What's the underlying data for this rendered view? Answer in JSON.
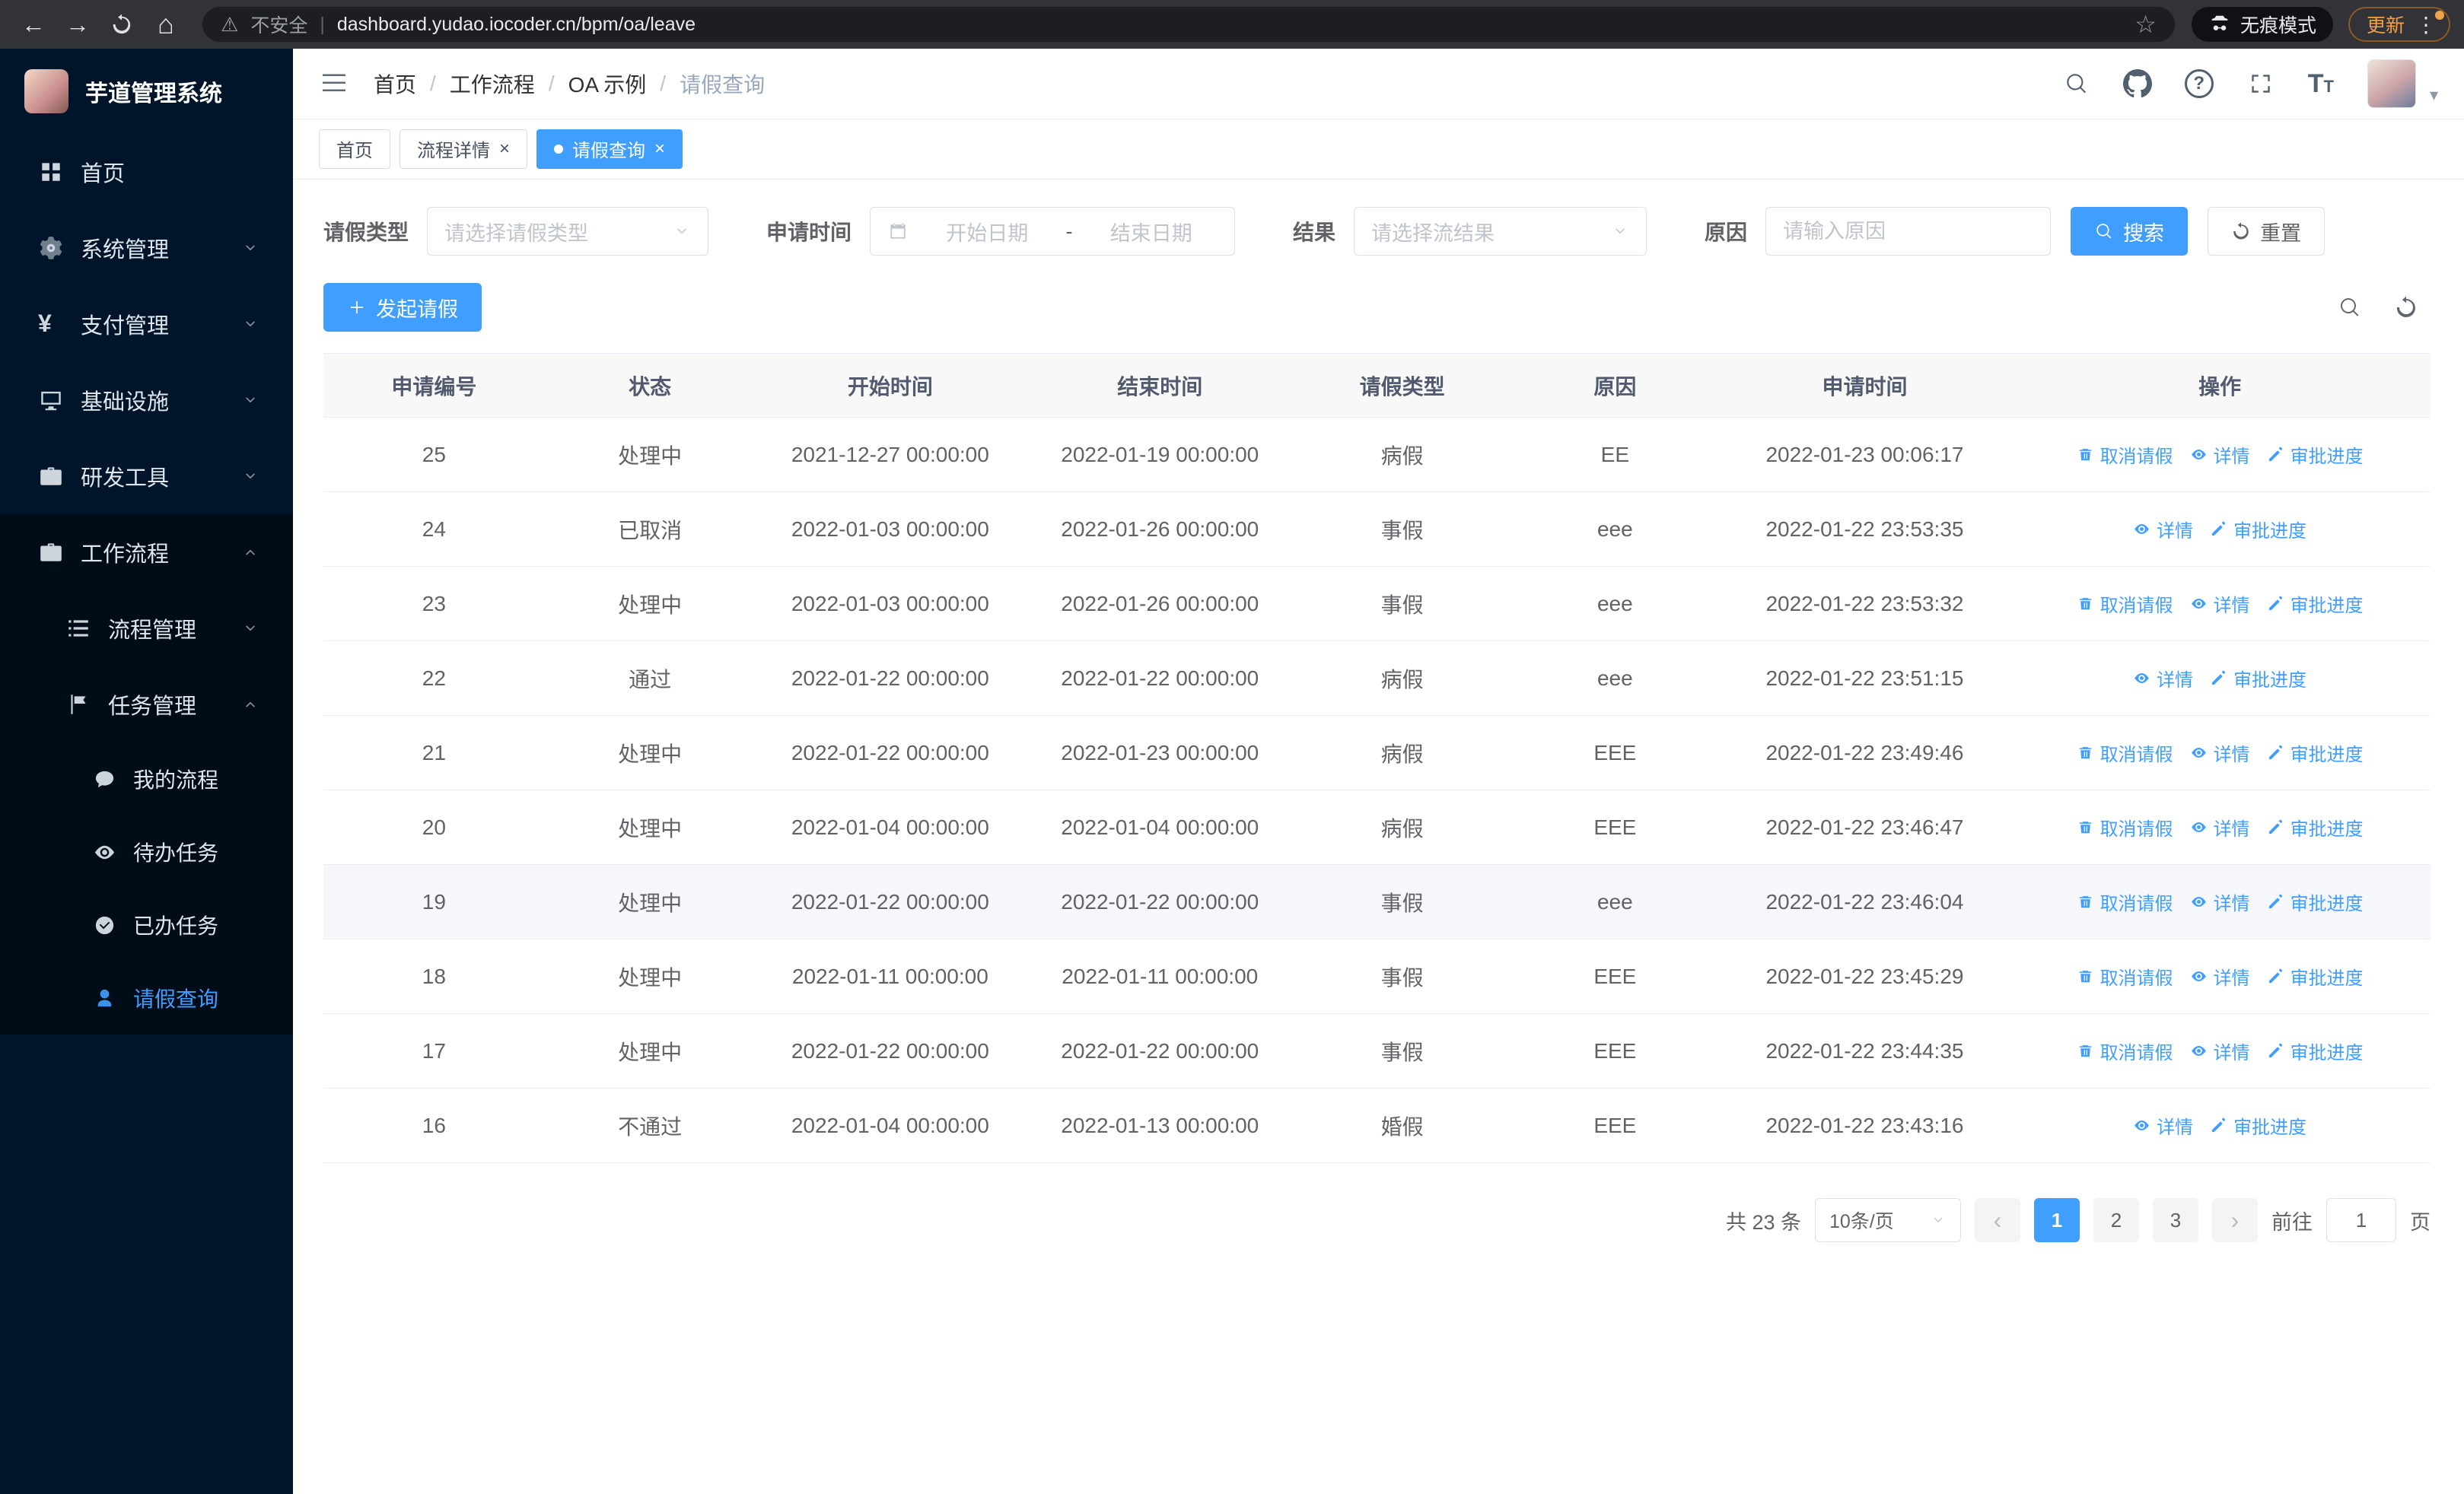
{
  "colors": {
    "accent": "#409eff",
    "sidebar_bg": "#001529",
    "sidebar_sub_bg": "#000c17"
  },
  "browser": {
    "security_label": "不安全",
    "url": "dashboard.yudao.iocoder.cn/bpm/oa/leave",
    "incognito_label": "无痕模式",
    "update_label": "更新"
  },
  "sidebar": {
    "title": "芋道管理系统",
    "items": [
      {
        "label": "首页"
      },
      {
        "label": "系统管理"
      },
      {
        "label": "支付管理"
      },
      {
        "label": "基础设施"
      },
      {
        "label": "研发工具"
      },
      {
        "label": "工作流程"
      },
      {
        "label": "流程管理"
      },
      {
        "label": "任务管理"
      },
      {
        "label": "我的流程"
      },
      {
        "label": "待办任务"
      },
      {
        "label": "已办任务"
      },
      {
        "label": "请假查询"
      }
    ]
  },
  "breadcrumb": [
    "首页",
    "工作流程",
    "OA 示例",
    "请假查询"
  ],
  "tabs": [
    {
      "label": "首页"
    },
    {
      "label": "流程详情"
    },
    {
      "label": "请假查询"
    }
  ],
  "filters": {
    "leave_type_label": "请假类型",
    "leave_type_placeholder": "请选择请假类型",
    "apply_time_label": "申请时间",
    "start_placeholder": "开始日期",
    "range_separator": "-",
    "end_placeholder": "结束日期",
    "result_label": "结果",
    "result_placeholder": "请选择流结果",
    "reason_label": "原因",
    "reason_placeholder": "请输入原因",
    "search_label": "搜索",
    "reset_label": "重置"
  },
  "toolbar": {
    "create_label": "发起请假"
  },
  "table": {
    "columns": [
      "申请编号",
      "状态",
      "开始时间",
      "结束时间",
      "请假类型",
      "原因",
      "申请时间",
      "操作"
    ],
    "action_labels": {
      "cancel": "取消请假",
      "detail": "详情",
      "progress": "审批进度"
    },
    "rows": [
      {
        "id": "25",
        "status": "处理中",
        "start": "2021-12-27 00:00:00",
        "end": "2022-01-19 00:00:00",
        "type": "病假",
        "reason": "EE",
        "applied": "2022-01-23 00:06:17",
        "cancelable": true,
        "highlighted": false
      },
      {
        "id": "24",
        "status": "已取消",
        "start": "2022-01-03 00:00:00",
        "end": "2022-01-26 00:00:00",
        "type": "事假",
        "reason": "eee",
        "applied": "2022-01-22 23:53:35",
        "cancelable": false,
        "highlighted": false
      },
      {
        "id": "23",
        "status": "处理中",
        "start": "2022-01-03 00:00:00",
        "end": "2022-01-26 00:00:00",
        "type": "事假",
        "reason": "eee",
        "applied": "2022-01-22 23:53:32",
        "cancelable": true,
        "highlighted": false
      },
      {
        "id": "22",
        "status": "通过",
        "start": "2022-01-22 00:00:00",
        "end": "2022-01-22 00:00:00",
        "type": "病假",
        "reason": "eee",
        "applied": "2022-01-22 23:51:15",
        "cancelable": false,
        "highlighted": false
      },
      {
        "id": "21",
        "status": "处理中",
        "start": "2022-01-22 00:00:00",
        "end": "2022-01-23 00:00:00",
        "type": "病假",
        "reason": "EEE",
        "applied": "2022-01-22 23:49:46",
        "cancelable": true,
        "highlighted": false
      },
      {
        "id": "20",
        "status": "处理中",
        "start": "2022-01-04 00:00:00",
        "end": "2022-01-04 00:00:00",
        "type": "病假",
        "reason": "EEE",
        "applied": "2022-01-22 23:46:47",
        "cancelable": true,
        "highlighted": false
      },
      {
        "id": "19",
        "status": "处理中",
        "start": "2022-01-22 00:00:00",
        "end": "2022-01-22 00:00:00",
        "type": "事假",
        "reason": "eee",
        "applied": "2022-01-22 23:46:04",
        "cancelable": true,
        "highlighted": true
      },
      {
        "id": "18",
        "status": "处理中",
        "start": "2022-01-11 00:00:00",
        "end": "2022-01-11 00:00:00",
        "type": "事假",
        "reason": "EEE",
        "applied": "2022-01-22 23:45:29",
        "cancelable": true,
        "highlighted": false
      },
      {
        "id": "17",
        "status": "处理中",
        "start": "2022-01-22 00:00:00",
        "end": "2022-01-22 00:00:00",
        "type": "事假",
        "reason": "EEE",
        "applied": "2022-01-22 23:44:35",
        "cancelable": true,
        "highlighted": false
      },
      {
        "id": "16",
        "status": "不通过",
        "start": "2022-01-04 00:00:00",
        "end": "2022-01-13 00:00:00",
        "type": "婚假",
        "reason": "EEE",
        "applied": "2022-01-22 23:43:16",
        "cancelable": false,
        "highlighted": false
      }
    ]
  },
  "pagination": {
    "total_label": "共 23 条",
    "page_size_label": "10条/页",
    "pages": [
      "1",
      "2",
      "3"
    ],
    "active_page": "1",
    "goto_label": "前往",
    "goto_value": "1",
    "goto_suffix": "页"
  }
}
